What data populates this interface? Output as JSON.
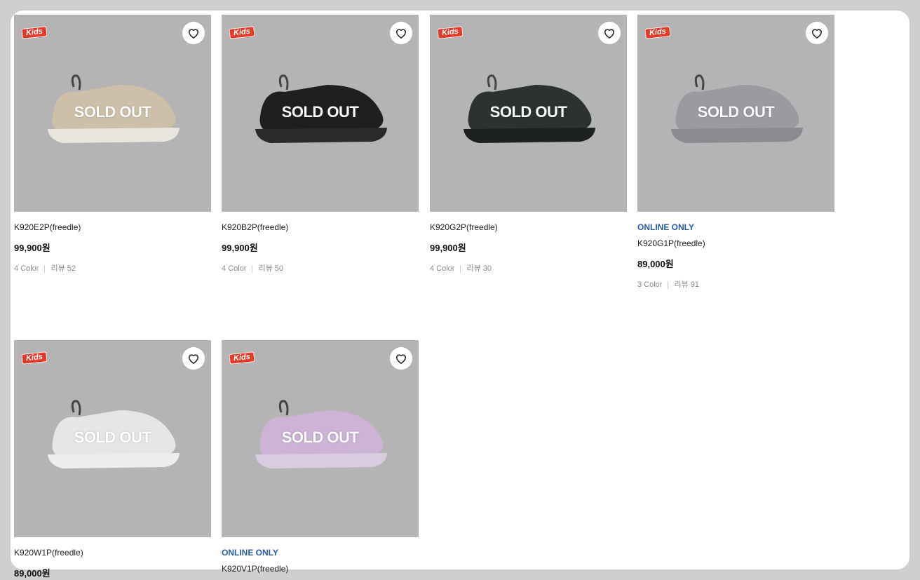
{
  "badge_text": "Kids",
  "soldout_text": "SOLD OUT",
  "colors": {
    "page_bg": "#cfcfcf",
    "thumb_bg": "#b4b4b4",
    "online_only": "#2a5aa8",
    "kids_badge": "#e23a2a"
  },
  "products": [
    {
      "online_only": "",
      "name": "K920E2P(freedle)",
      "price": "99,900원",
      "colors": "4 Color",
      "reviews": "리뷰 52",
      "shoe_color": "#cdbfa8",
      "sole_color": "#e8e6df"
    },
    {
      "online_only": "",
      "name": "K920B2P(freedle)",
      "price": "99,900원",
      "colors": "4 Color",
      "reviews": "리뷰 50",
      "shoe_color": "#1f1f1f",
      "sole_color": "#2a2a2a"
    },
    {
      "online_only": "",
      "name": "K920G2P(freedle)",
      "price": "99,900원",
      "colors": "4 Color",
      "reviews": "리뷰 30",
      "shoe_color": "#2b3230",
      "sole_color": "#1d2120"
    },
    {
      "online_only": "ONLINE ONLY",
      "name": "K920G1P(freedle)",
      "price": "89,000원",
      "colors": "3 Color",
      "reviews": "리뷰 91",
      "shoe_color": "#9a9aa0",
      "sole_color": "#8a8a90"
    },
    {
      "online_only": "",
      "name": "K920W1P(freedle)",
      "price": "89,000원",
      "colors": "",
      "reviews": "",
      "shoe_color": "#e6e6e8",
      "sole_color": "#ededee"
    },
    {
      "online_only": "ONLINE ONLY",
      "name": "K920V1P(freedle)",
      "price": "",
      "colors": "",
      "reviews": "",
      "shoe_color": "#cdb3d6",
      "sole_color": "#d9cbe0"
    }
  ]
}
